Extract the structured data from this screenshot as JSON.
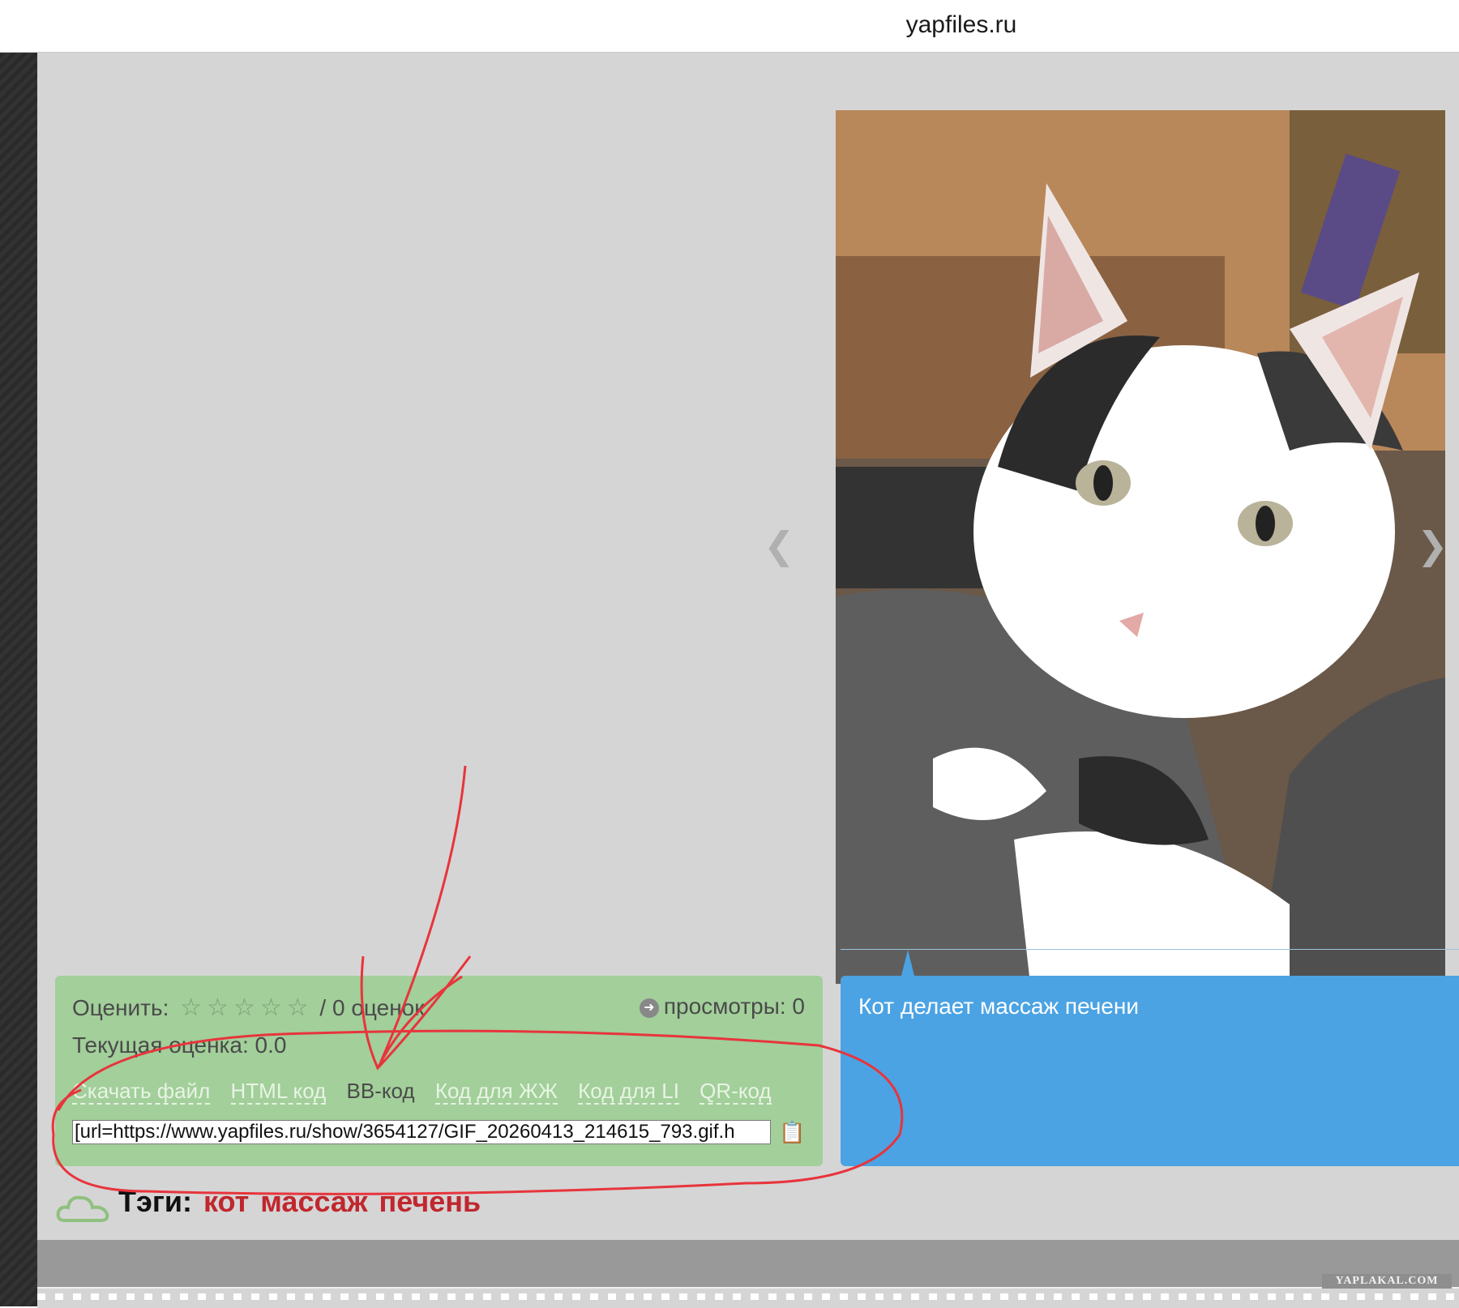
{
  "browser": {
    "url": "yapfiles.ru"
  },
  "rating": {
    "label": "Оценить:",
    "stars": "☆☆☆☆☆",
    "count_text": "/ 0 оценок",
    "current_label": "Текущая оценка: 0.0",
    "views_label": "просмотры: 0"
  },
  "code_tabs": [
    {
      "label": "Скачать файл"
    },
    {
      "label": "HTML код"
    },
    {
      "label": "BB-код"
    },
    {
      "label": "Код для ЖЖ"
    },
    {
      "label": "Код для LI"
    },
    {
      "label": "QR-код"
    }
  ],
  "code_field": {
    "value": "[url=https://www.yapfiles.ru/show/3654127/GIF_20260413_214615_793.gif.h"
  },
  "description": {
    "text": "Кот делает массаж печени"
  },
  "tags": {
    "label": "Тэги:",
    "items": [
      "кот",
      "массаж",
      "печень"
    ]
  },
  "watermark": "YAPLAKAL.COM",
  "colors": {
    "rating_panel": "#a2cf9a",
    "description_panel": "#4ba3e3",
    "tag_link": "#c0272d",
    "annotation": "#e8343c"
  }
}
